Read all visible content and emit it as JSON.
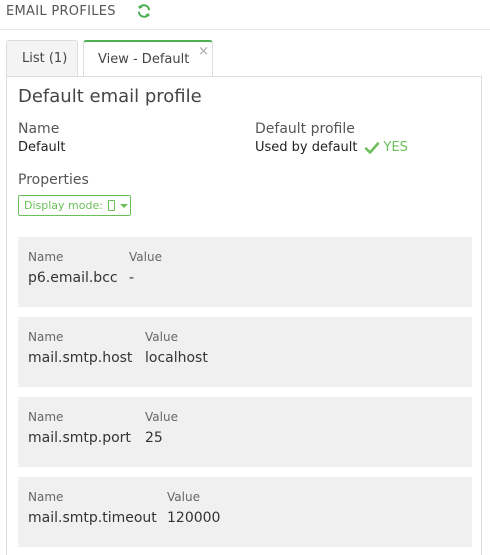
{
  "header": {
    "title": "EMAIL PROFILES",
    "refresh_icon": "refresh-icon"
  },
  "tabs": [
    {
      "label": "List (1)",
      "active": false
    },
    {
      "label": "View - Default",
      "active": true,
      "close": "×"
    }
  ],
  "profile": {
    "title": "Default email profile",
    "name_label": "Name",
    "name_value": "Default",
    "default_label": "Default profile",
    "default_value": "Used by default",
    "default_flag": "YES",
    "properties_label": "Properties",
    "display_mode_label": "Display mode:"
  },
  "properties": [
    {
      "name_label": "Name",
      "value_label": "Value",
      "name": "p6.email.bcc",
      "value": "-"
    },
    {
      "name_label": "Name",
      "value_label": "Value",
      "name": "mail.smtp.host",
      "value": "localhost"
    },
    {
      "name_label": "Name",
      "value_label": "Value",
      "name": "mail.smtp.port",
      "value": "25"
    },
    {
      "name_label": "Name",
      "value_label": "Value",
      "name": "mail.smtp.timeout",
      "value": "120000"
    }
  ],
  "colors": {
    "accent_green": "#6bbf59",
    "card_bg": "#f0f0f0"
  }
}
